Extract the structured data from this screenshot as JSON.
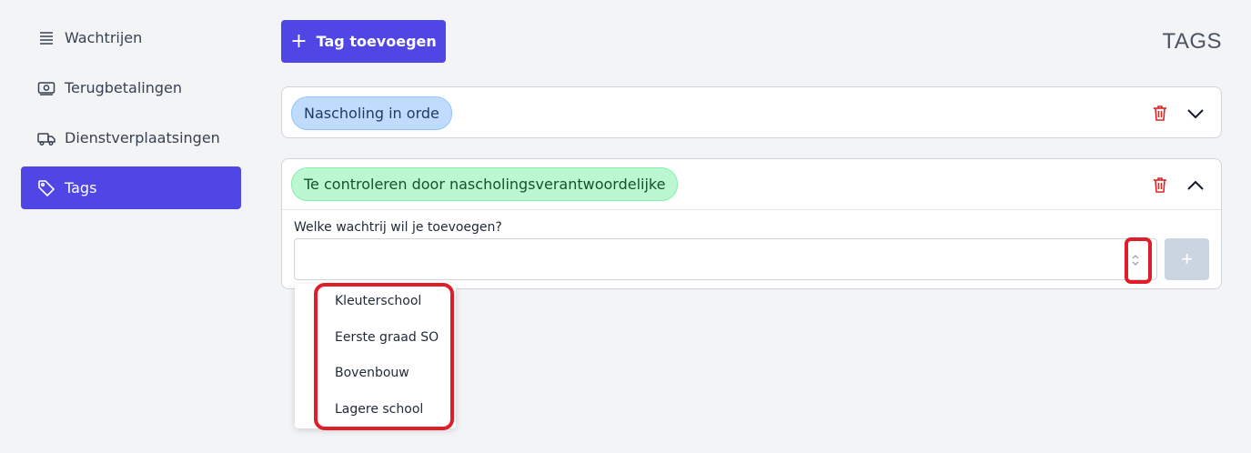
{
  "sidebar": {
    "items": [
      {
        "label": "Wachtrijen",
        "icon": "list-icon",
        "active": false
      },
      {
        "label": "Terugbetalingen",
        "icon": "money-icon",
        "active": false
      },
      {
        "label": "Dienstverplaatsingen",
        "icon": "truck-icon",
        "active": false
      },
      {
        "label": "Tags",
        "icon": "tag-icon",
        "active": true
      }
    ]
  },
  "header": {
    "add_button_label": "Tag toevoegen",
    "page_title": "TAGS"
  },
  "tags": [
    {
      "label": "Nascholing in orde",
      "color": "#bfdbfe",
      "expanded": false
    },
    {
      "label": "Te controleren door nascholingsverantwoordelijke",
      "color": "#bbf7d0",
      "expanded": true
    }
  ],
  "queue_form": {
    "label": "Welke wachtrij wil je toevoegen?",
    "value": "",
    "options": [
      "Kleuterschool",
      "Eerste graad SO",
      "Bovenbouw",
      "Lagere school"
    ]
  },
  "colors": {
    "accent": "#4f46e5",
    "danger": "#dc2626",
    "highlight": "#e11d2a"
  }
}
